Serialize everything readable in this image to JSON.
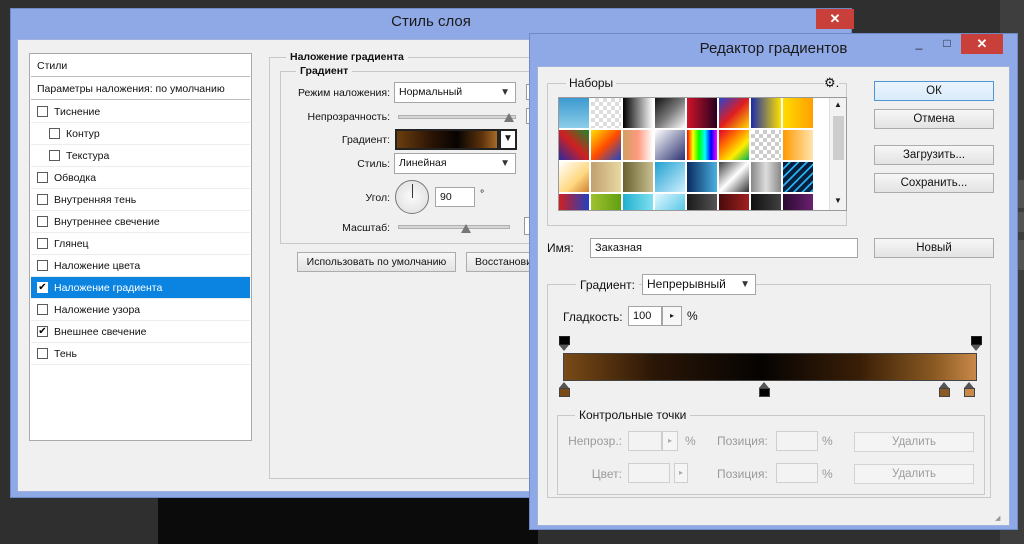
{
  "layer_style": {
    "title": "Стиль слоя",
    "close": "✕",
    "styles_header": "Стили",
    "blend_options": "Параметры наложения: по умолчанию",
    "items": [
      {
        "label": "Тиснение",
        "checked": false,
        "indent": false
      },
      {
        "label": "Контур",
        "checked": false,
        "indent": true
      },
      {
        "label": "Текстура",
        "checked": false,
        "indent": true
      },
      {
        "label": "Обводка",
        "checked": false,
        "indent": false
      },
      {
        "label": "Внутренняя тень",
        "checked": false,
        "indent": false
      },
      {
        "label": "Внутреннее свечение",
        "checked": false,
        "indent": false
      },
      {
        "label": "Глянец",
        "checked": false,
        "indent": false
      },
      {
        "label": "Наложение цвета",
        "checked": false,
        "indent": false
      },
      {
        "label": "Наложение градиента",
        "checked": true,
        "indent": false,
        "selected": true
      },
      {
        "label": "Наложение узора",
        "checked": false,
        "indent": false
      },
      {
        "label": "Внешнее свечение",
        "checked": true,
        "indent": false
      },
      {
        "label": "Тень",
        "checked": false,
        "indent": false
      }
    ],
    "section_title": "Наложение градиента",
    "group_title": "Градиент",
    "blend_mode_label": "Режим наложения:",
    "blend_mode_value": "Нормальный",
    "opacity_label": "Непрозрачность:",
    "gradient_label": "Градиент:",
    "style_label": "Стиль:",
    "style_value": "Линейная",
    "angle_label": "Угол:",
    "angle_value": "90",
    "degree": "°",
    "scale_label": "Масштаб:",
    "default_button": "Использовать по умолчанию",
    "restore_button": "Восстанови"
  },
  "gradient_editor": {
    "title": "Редактор градиентов",
    "minimize": "_",
    "maximize": "□",
    "close": "✕",
    "presets_label": "Наборы",
    "ok": "ОК",
    "cancel": "Отмена",
    "load": "Загрузить...",
    "save": "Сохранить...",
    "name_label": "Имя:",
    "name_value": "Заказная",
    "new_button": "Новый",
    "gradient_type_label": "Градиент:",
    "gradient_type_value": "Непрерывный",
    "smoothness_label": "Гладкость:",
    "smoothness_value": "100",
    "percent": "%",
    "stops_group": "Контрольные точки",
    "opacity_label": "Непрозр.:",
    "color_label": "Цвет:",
    "position_label": "Позиция:",
    "delete_button": "Удалить",
    "gradient_colors": [
      "#7a4a16",
      "#2a1606",
      "#050302",
      "#3a1f07",
      "#8b5a22",
      "#c9894a"
    ]
  }
}
